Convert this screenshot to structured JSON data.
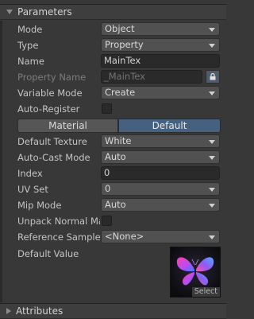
{
  "sections": {
    "parameters": {
      "title": "Parameters",
      "expanded": true
    },
    "attributes": {
      "title": "Attributes",
      "expanded": false
    }
  },
  "fields": {
    "mode": {
      "label": "Mode",
      "value": "Object"
    },
    "type": {
      "label": "Type",
      "value": "Property"
    },
    "name": {
      "label": "Name",
      "value": "MainTex"
    },
    "property_name": {
      "label": "Property Name",
      "value": "_MainTex",
      "locked": true
    },
    "variable_mode": {
      "label": "Variable Mode",
      "value": "Create"
    },
    "auto_register": {
      "label": "Auto-Register",
      "checked": false
    },
    "default_texture": {
      "label": "Default Texture",
      "value": "White"
    },
    "auto_cast_mode": {
      "label": "Auto-Cast Mode",
      "value": "Auto"
    },
    "index": {
      "label": "Index",
      "value": "0"
    },
    "uv_set": {
      "label": "UV Set",
      "value": "0"
    },
    "mip_mode": {
      "label": "Mip Mode",
      "value": "Auto"
    },
    "unpack_normal_map": {
      "label": "Unpack Normal Ma",
      "checked": false
    },
    "reference_sampler": {
      "label": "Reference Sample",
      "value": "<None>"
    },
    "default_value": {
      "label": "Default Value",
      "select_label": "Select"
    }
  },
  "toggle": {
    "left": "Material",
    "right": "Default",
    "selected": "Default"
  },
  "icons": {
    "section_expanded": "triangle-down-icon",
    "section_collapsed": "triangle-right-icon",
    "dropdown": "chevron-down-icon",
    "lock": "lock-icon",
    "thumbnail": "butterfly-texture"
  },
  "colors": {
    "background": "#383838",
    "selected_toggle": "#46607f",
    "text": "#c4c4c4"
  }
}
